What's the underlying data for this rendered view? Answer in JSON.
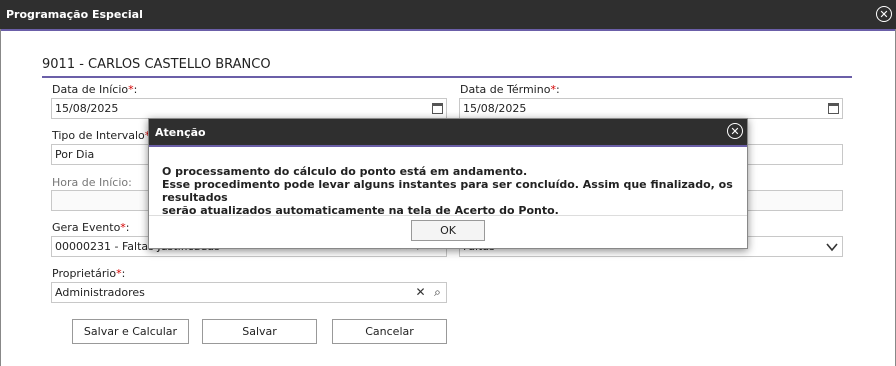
{
  "window": {
    "title": "Programação Especial",
    "close_icon": "close-icon"
  },
  "employee_header": "9011 - CARLOS CASTELLO BRANCO",
  "form": {
    "data_inicio": {
      "label": "Data de Início",
      "value": "15/08/2025"
    },
    "data_termino": {
      "label": "Data de Término",
      "value": "15/08/2025"
    },
    "tipo_intervalo": {
      "label": "Tipo de Intervalo",
      "value": "Por Dia"
    },
    "hora_inicio": {
      "label": "Hora de Início:",
      "value": ""
    },
    "gera_evento": {
      "label": "Gera Evento",
      "value": "00000231 - Faltas Justificadas"
    },
    "evento_right": {
      "value": "Faltas"
    },
    "proprietario": {
      "label": "Proprietário",
      "value": "Administradores"
    },
    "required_mark": "*",
    "colon": ":"
  },
  "buttons": {
    "save_calc": "Salvar e Calcular",
    "save": "Salvar",
    "cancel": "Cancelar"
  },
  "dialog": {
    "title": "Atenção",
    "line1": "O processamento do cálculo do ponto está em andamento.",
    "line2": "Esse procedimento pode levar alguns instantes para ser concluído. Assim que finalizado, os resultados",
    "line3": "serão atualizados automaticamente na tela de Acerto do Ponto.",
    "ok": "OK"
  },
  "colors": {
    "titlebar": "#2f2f2f",
    "accent": "#6b5fa8",
    "required": "#d40000"
  }
}
